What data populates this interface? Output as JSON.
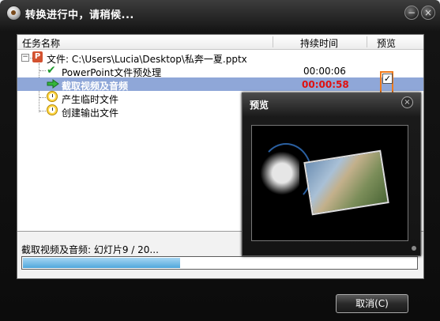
{
  "window": {
    "title": "转换进行中，请稍候...",
    "minimize_glyph": "−",
    "close_glyph": "×"
  },
  "list": {
    "columns": [
      "任务名称",
      "持续时间",
      "预览"
    ],
    "expander_glyph": "−",
    "file_icon_letter": "P",
    "file_label": "文件: C:\\Users\\Lucia\\Desktop\\私奔一夏.pptx",
    "tasks": [
      {
        "name": "PowerPoint文件预处理",
        "duration": "00:00:06",
        "icon": "check-icon"
      },
      {
        "name": "截取视频及音频",
        "duration": "00:00:58",
        "icon": "arrow-right-icon",
        "selected": true,
        "preview_checked": true
      },
      {
        "name": "产生临时文件",
        "duration": "",
        "icon": "clock-icon"
      },
      {
        "name": "创建输出文件",
        "duration": "",
        "icon": "clock-icon"
      }
    ],
    "check_glyph": "✔",
    "checkbox_glyph": "✓"
  },
  "preview": {
    "title": "预览",
    "close_glyph": "×"
  },
  "status": {
    "text": "截取视频及音频: 幻灯片9 / 20...",
    "progress_fraction": 0.4
  },
  "footer": {
    "cancel_label": "取消(C)"
  },
  "colors": {
    "selected_row": "#8fa7d8",
    "running_time": "#e01010",
    "highlight_box": "#f07a1a",
    "progress_fill": "#4fa7dc"
  }
}
